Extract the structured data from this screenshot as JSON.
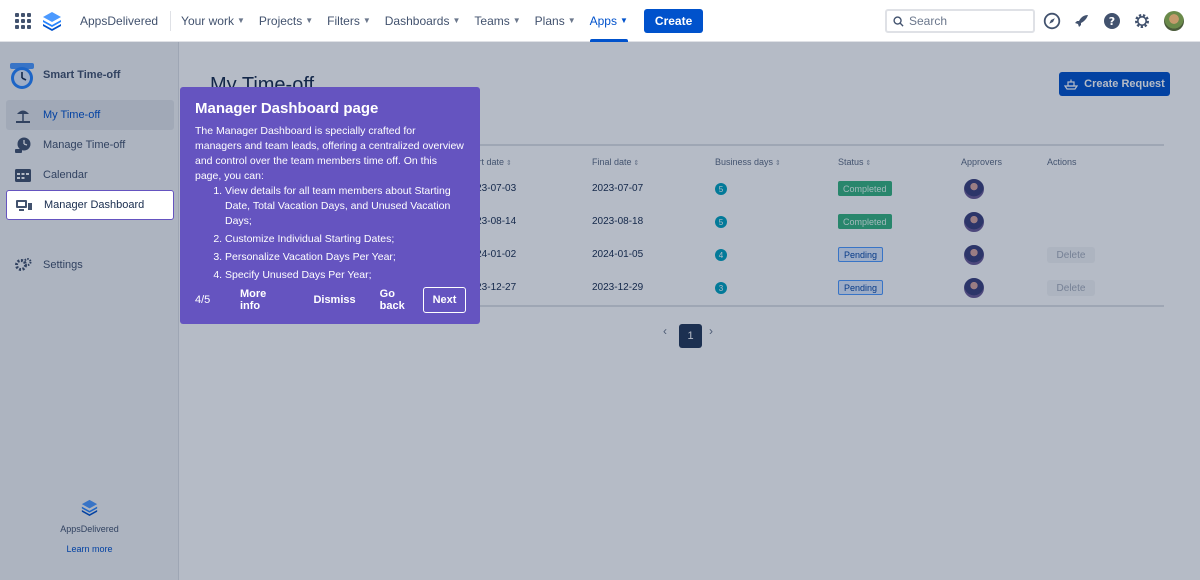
{
  "topnav": {
    "brand": "AppsDelivered",
    "items": [
      {
        "label": "Your work"
      },
      {
        "label": "Projects"
      },
      {
        "label": "Filters"
      },
      {
        "label": "Dashboards"
      },
      {
        "label": "Teams"
      },
      {
        "label": "Plans"
      },
      {
        "label": "Apps"
      }
    ],
    "active": "Apps",
    "create_label": "Create",
    "search_placeholder": "Search",
    "accent": "#0052cc"
  },
  "sidebar": {
    "app_name": "Smart Time-off",
    "items": [
      {
        "label": "My Time-off",
        "icon": "beach-icon"
      },
      {
        "label": "Manage Time-off",
        "icon": "clock-icon"
      },
      {
        "label": "Calendar",
        "icon": "calendar-icon"
      },
      {
        "label": "Manager Dashboard",
        "icon": "dashboard-icon"
      },
      {
        "label": "Settings",
        "icon": "gear-icon"
      }
    ],
    "footer_brand": "AppsDelivered",
    "footer_link": "Learn more"
  },
  "main": {
    "title": "My Time-off",
    "create_request": "Create Request",
    "columns": [
      "Start date",
      "Final date",
      "Business days",
      "Status",
      "Approvers",
      "Actions"
    ],
    "rows": [
      {
        "start": "2023-07-03",
        "final": "2023-07-07",
        "days": "5",
        "status": "Completed",
        "action": ""
      },
      {
        "start": "2023-08-14",
        "final": "2023-08-18",
        "days": "5",
        "status": "Completed",
        "action": ""
      },
      {
        "start": "2024-01-02",
        "final": "2024-01-05",
        "days": "4",
        "status": "Pending",
        "action": "Delete"
      },
      {
        "start": "2023-12-27",
        "final": "2023-12-29",
        "days": "3",
        "status": "Pending",
        "action": "Delete"
      }
    ],
    "pagination": {
      "current": "1",
      "prev": "‹",
      "next": "›"
    },
    "status_colors": {
      "completed": "#36b37e",
      "pending": "#deebff"
    }
  },
  "tour": {
    "title": "Manager Dashboard page",
    "intro": "The Manager Dashboard is specially crafted for managers and team leads, offering a centralized overview and control over the team members time off. On this page, you can:",
    "steps": [
      "View details for all team members about Starting Date, Total Vacation Days, and Unused Vacation Days;",
      "Customize Individual Starting Dates;",
      "Personalize Vacation Days Per Year;",
      "Specify Unused Days Per Year;"
    ],
    "step_counter": "4/5",
    "more_info": "More info",
    "dismiss": "Dismiss",
    "go_back": "Go back",
    "next": "Next",
    "color": "#6554c0"
  }
}
